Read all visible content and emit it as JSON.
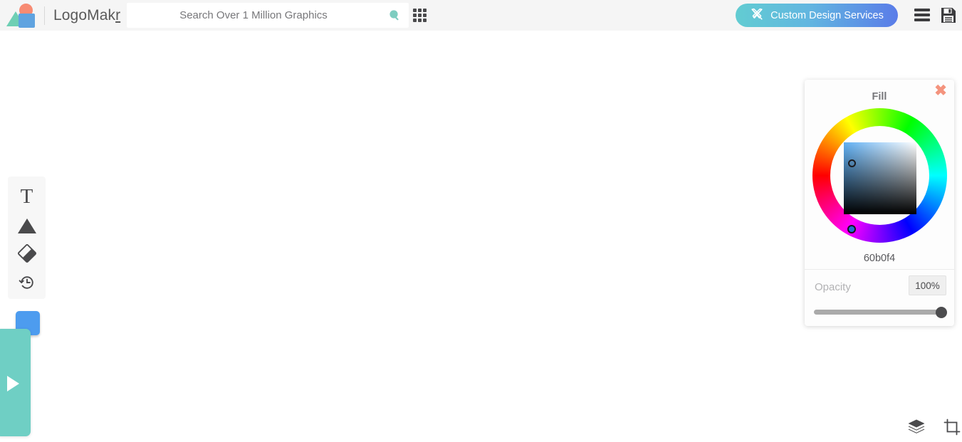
{
  "header": {
    "brand_name_main": "LogoMak",
    "brand_name_accent": "r",
    "logo_icon": "logomakr-shapes-logo",
    "search": {
      "placeholder": "Search Over 1 Million Graphics",
      "value": "",
      "icon": "search-icon",
      "icon_color": "#7dcdc0"
    },
    "grid_icon": "apps-grid-icon",
    "custom_design_button": {
      "label": "Custom Design Services",
      "icon": "crossed-pencil-ruler-icon",
      "gradient_start": "#62ccd2",
      "gradient_end": "#5a7ce8"
    },
    "menu_icon": "hamburger-menu-icon",
    "save_icon": "floppy-disk-save-icon",
    "background": "#f5f5f5"
  },
  "toolbar": {
    "tools": [
      {
        "name": "text-tool",
        "icon": "text-T-icon",
        "glyph": "T"
      },
      {
        "name": "shape-tool",
        "icon": "triangle-shape-icon",
        "glyph": ""
      },
      {
        "name": "fill-tool",
        "icon": "paint-fill-icon",
        "glyph": ""
      },
      {
        "name": "history-tool",
        "icon": "history-clock-icon",
        "glyph": ""
      }
    ],
    "color_swatch": {
      "name": "active-color-swatch",
      "color": "#4d9cef"
    },
    "side_panel": {
      "name": "graphics-drawer",
      "color": "#6fcfc4",
      "icon": "play-arrow-expand-icon"
    }
  },
  "fill_panel": {
    "title": "Fill",
    "close_icon": "close-x-icon",
    "close_color": "#f4947e",
    "hex_value": "60b0f4",
    "selected_color": "#60b0f4",
    "opacity": {
      "label": "Opacity",
      "value": "100%",
      "slider_percent": 100
    },
    "color_wheel_icon": "hue-color-wheel",
    "saturation_square_icon": "saturation-value-square"
  },
  "footer_icons": [
    {
      "name": "layers-icon",
      "label": "Layers"
    },
    {
      "name": "crop-icon",
      "label": "Crop"
    }
  ],
  "canvas": {
    "background": "#ffffff"
  }
}
